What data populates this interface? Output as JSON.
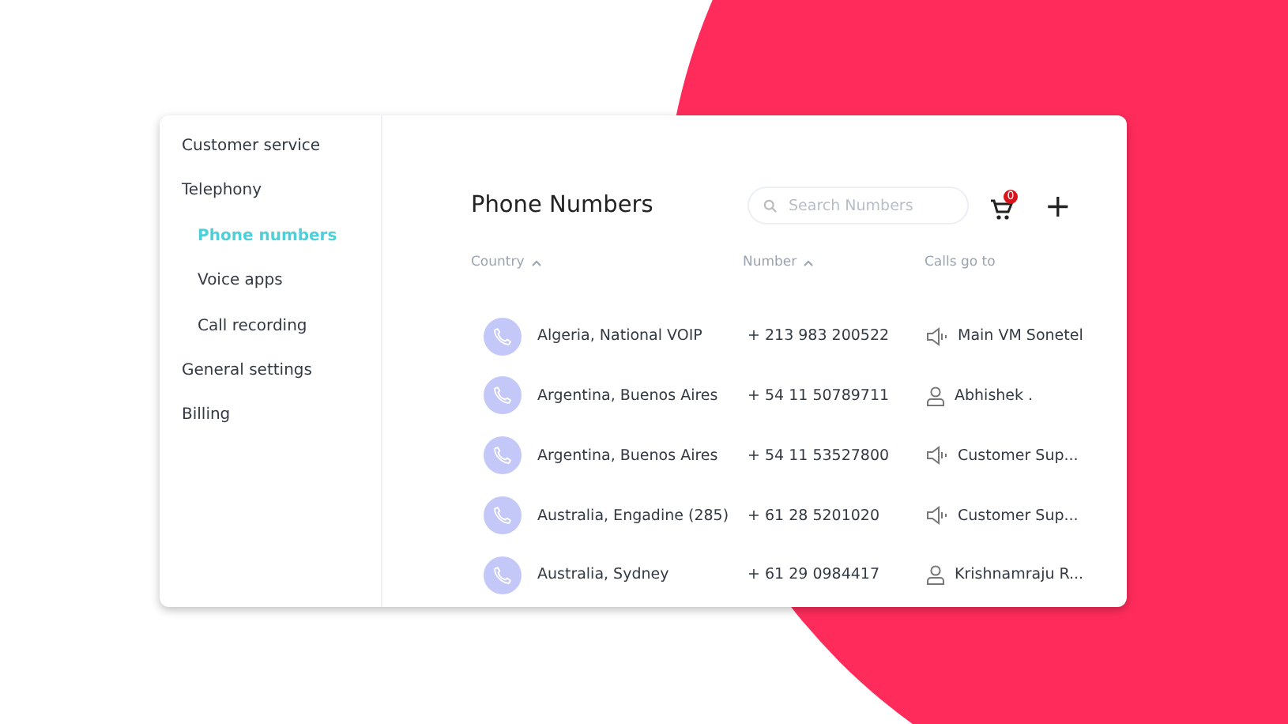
{
  "sidebar": {
    "items": [
      {
        "label": "Customer service",
        "selected": false
      },
      {
        "label": "Telephony",
        "selected": false,
        "children": [
          {
            "label": "Phone numbers",
            "selected": true
          },
          {
            "label": "Voice apps",
            "selected": false
          },
          {
            "label": "Call recording",
            "selected": false
          }
        ]
      },
      {
        "label": "General settings",
        "selected": false
      },
      {
        "label": "Billing",
        "selected": false
      }
    ]
  },
  "header": {
    "title": "Phone Numbers",
    "search": {
      "placeholder": "Search Numbers"
    },
    "cart_badge": "0",
    "add_button": "+"
  },
  "table": {
    "columns": [
      {
        "label": "Country",
        "sortable": true
      },
      {
        "label": "Number",
        "sortable": true
      },
      {
        "label": "Calls go to",
        "sortable": false
      }
    ],
    "rows": [
      {
        "country": "Algeria, National VOIP",
        "number": "+ 213 983 200522",
        "destination": "Main VM Sonetel",
        "kind": "voice-app"
      },
      {
        "country": "Argentina, Buenos Aires",
        "number": "+ 54 11 50789711",
        "destination": "Abhishek .",
        "kind": "user"
      },
      {
        "country": "Argentina, Buenos Aires",
        "number": "+ 54 11 53527800",
        "destination": "Customer Sup...",
        "kind": "voice-app"
      },
      {
        "country": "Australia, Engadine (285)",
        "number": "+ 61 28 5201020",
        "destination": "Customer Sup...",
        "kind": "voice-app"
      },
      {
        "country": "Australia, Sydney",
        "number": "+ 61 29 0984417",
        "destination": "Krishnamraju R...",
        "kind": "user"
      }
    ]
  }
}
